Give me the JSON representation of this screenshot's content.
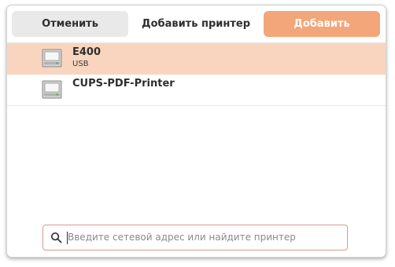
{
  "header": {
    "cancel_label": "Отменить",
    "title": "Добавить принтер",
    "add_label": "Добавить"
  },
  "printers": [
    {
      "name": "E400",
      "connection": "USB",
      "selected": true,
      "icon": "printer-icon"
    },
    {
      "name": "CUPS-PDF-Printer",
      "connection": "",
      "selected": false,
      "icon": "printer-icon"
    }
  ],
  "search": {
    "placeholder": "Введите сетевой адрес или найдите принтер",
    "value": "",
    "icon": "search-icon"
  },
  "colors": {
    "accent": "#f3a679",
    "selected_row": "#f9d5bf",
    "cancel_bg": "#e9e9e9",
    "search_border": "#d99a8e"
  }
}
